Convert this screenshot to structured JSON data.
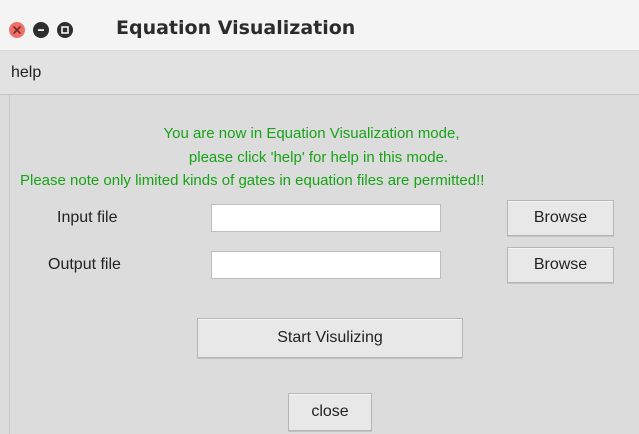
{
  "window": {
    "title": "Equation Visualization",
    "controls": [
      "close-icon",
      "minimize-icon",
      "maximize-icon"
    ],
    "close_color": "#ee6f6a"
  },
  "menu": {
    "items": [
      "help"
    ]
  },
  "messages": {
    "line1": "You are now in Equation Visualization mode,",
    "line2": "please click 'help' for help in this mode.",
    "line3": "Please note only limited kinds of gates in equation files are permitted!!",
    "color": "#17a317"
  },
  "form": {
    "input_label": "Input file",
    "input_value": "",
    "output_label": "Output file",
    "output_value": "",
    "browse_label": "Browse"
  },
  "actions": {
    "start_label": "Start Visulizing",
    "close_label": "close"
  }
}
